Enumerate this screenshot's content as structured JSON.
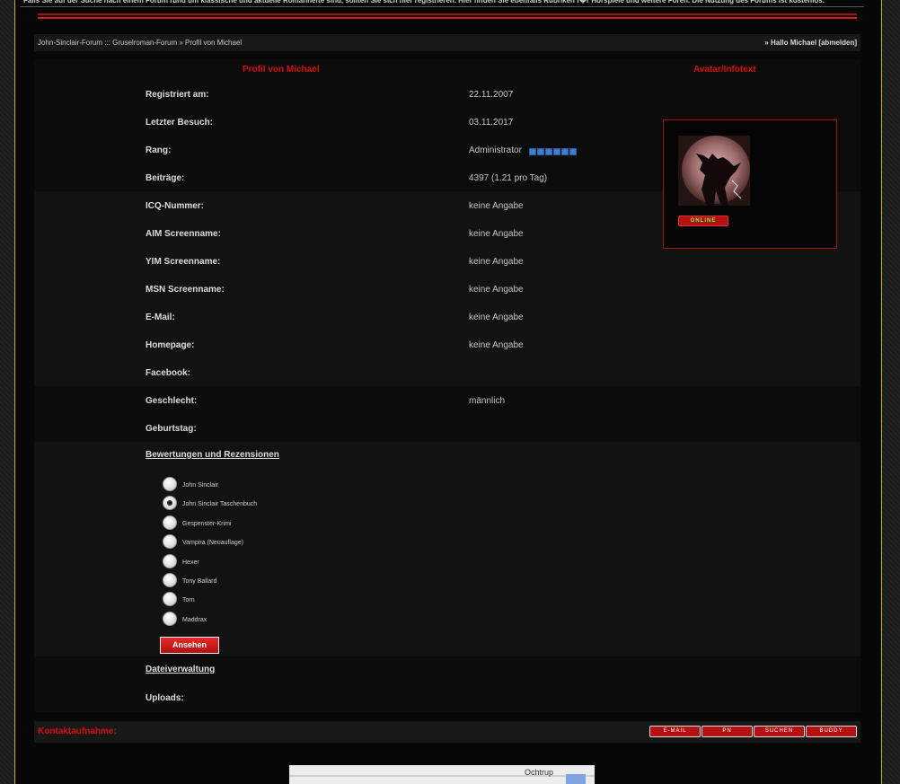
{
  "header": {
    "notice": "Falls Sie auf der Suche nach einem Forum rund um klassische und aktuelle Romanhefte sind, sollten Sie sich hier registrieren. Hier finden Sie ebenfalls Rubriken f�r Hörspiele und weitere Foren. Die Nutzung des Forums ist kostenlos."
  },
  "breadcrumb": {
    "text": "John-Sinclair-Forum ::: Gruselroman-Forum » Profil von Michael",
    "greeting": "» Hallo Michael [abmelden]"
  },
  "profile": {
    "title": "Profil von Michael",
    "avatar_title": "Avatar/Infotext",
    "online_badge": "ONLINE",
    "rows": [
      {
        "label": "Registriert am:",
        "value": "22.11.2007"
      },
      {
        "label": "Letzter Besuch:",
        "value": "03.11.2017"
      },
      {
        "label": "Rang:",
        "value": "Administrator"
      },
      {
        "label": "Beiträge:",
        "value": "4397 (1.21 pro Tag)"
      },
      {
        "label": "ICQ-Nummer:",
        "value": "keine Angabe"
      },
      {
        "label": "AIM Screenname:",
        "value": "keine Angabe"
      },
      {
        "label": "YIM Screenname:",
        "value": "keine Angabe"
      },
      {
        "label": "MSN Screenname:",
        "value": "keine Angabe"
      },
      {
        "label": "E-Mail:",
        "value": "keine Angabe"
      },
      {
        "label": "Homepage:",
        "value": "keine Angabe"
      },
      {
        "label": "Facebook:",
        "value": ""
      },
      {
        "label": "Geschlecht:",
        "value": "männlich"
      },
      {
        "label": "Geburtstag:",
        "value": ""
      }
    ],
    "rank_squares": 6
  },
  "ratings": {
    "heading": "Bewertungen und Rezensionen",
    "options": [
      {
        "label": "John Sinclair",
        "checked": false
      },
      {
        "label": "John Sinclair Taschenbuch",
        "checked": true
      },
      {
        "label": "Gespenster-Krimi",
        "checked": false
      },
      {
        "label": "Vampira (Neuauflage)",
        "checked": false
      },
      {
        "label": "Hexer",
        "checked": false
      },
      {
        "label": "Tony Ballard",
        "checked": false
      },
      {
        "label": "Torn",
        "checked": false
      },
      {
        "label": "Maddrax",
        "checked": false
      }
    ],
    "button_label": "Ansehen"
  },
  "files": {
    "heading": "Dateiverwaltung",
    "uploads_label": "Uploads:"
  },
  "contact": {
    "title": "Kontaktaufnahme:",
    "buttons": [
      "E-MAIL",
      "PN",
      "SUCHEN",
      "BUDDY"
    ]
  },
  "map": {
    "label": "Ochtrup"
  },
  "colors": {
    "accent_red": "#d51010",
    "frame_yellow": "#c9b400",
    "rank_blue": "#3f7fd0"
  }
}
